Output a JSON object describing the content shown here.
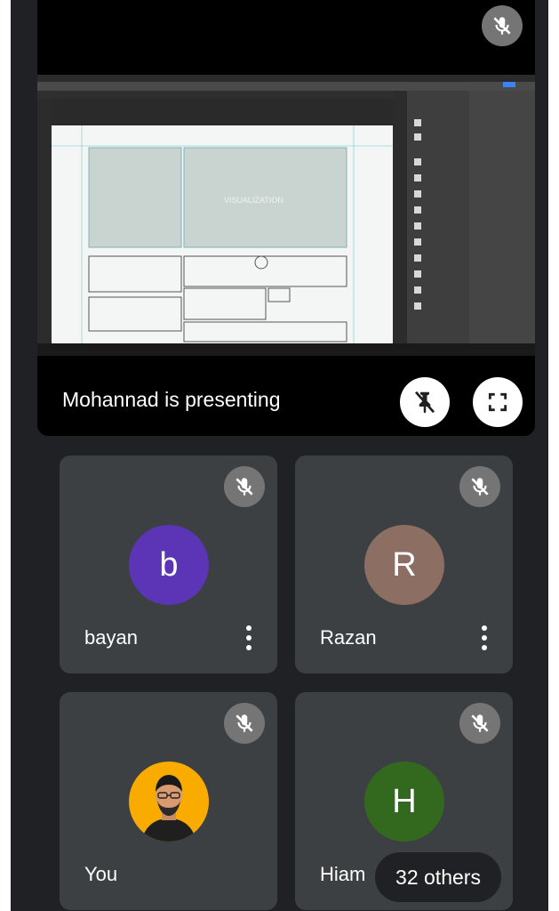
{
  "presentation": {
    "status_text": "Mohannad is presenting",
    "shared_screen_center_text": "VISUALIZATION"
  },
  "participants": [
    {
      "name": "bayan",
      "avatar_letter": "b",
      "avatar_color": "#5b35b5",
      "muted": true,
      "has_menu": true
    },
    {
      "name": "Razan",
      "avatar_letter": "R",
      "avatar_color": "#8d6e63",
      "muted": true,
      "has_menu": true
    },
    {
      "name": "You",
      "avatar_letter": "",
      "avatar_color": "#f9ab00",
      "muted": true,
      "has_menu": false
    },
    {
      "name": "Hiam",
      "avatar_letter": "H",
      "avatar_color": "#33691e",
      "muted": true,
      "has_menu": false
    }
  ],
  "others_pill": "32 others",
  "icons": {
    "mic_off": "mic-off-icon",
    "unpin": "unpin-icon",
    "fullscreen": "fullscreen-icon",
    "more": "more-vert-icon"
  },
  "colors": {
    "call_bg": "#202124",
    "tile_bg": "#3c4043",
    "mute_badge": "#757575"
  }
}
